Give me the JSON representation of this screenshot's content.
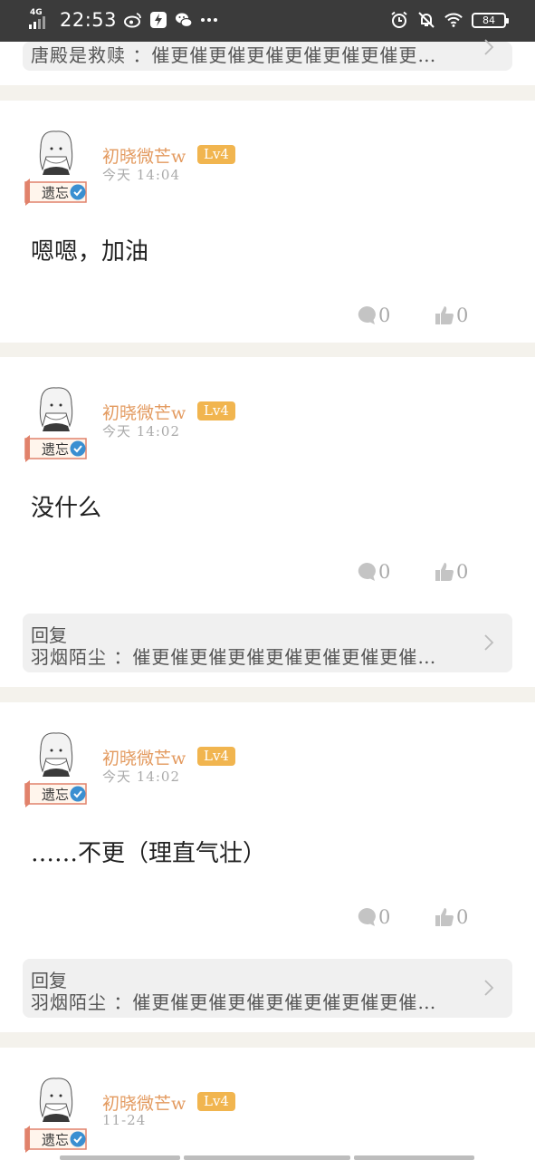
{
  "status_bar": {
    "network": "4G",
    "time": "22:53",
    "battery": "84"
  },
  "top_reply": {
    "text": "唐殿是救赎 ：催更催更催更催更催更催更催更…"
  },
  "comments": [
    {
      "username": "初晓微芒w",
      "level": "Lv4",
      "badge": "遗忘",
      "time": "今天 14:04",
      "content": "嗯嗯，加油",
      "reply_count": "0",
      "like_count": "0"
    },
    {
      "username": "初晓微芒w",
      "level": "Lv4",
      "badge": "遗忘",
      "time": "今天 14:02",
      "content": "没什么",
      "reply_count": "0",
      "like_count": "0",
      "reply": {
        "title": "回复",
        "text": "羽烟陌尘 ：催更催更催更催更催更催更催更催…"
      }
    },
    {
      "username": "初晓微芒w",
      "level": "Lv4",
      "badge": "遗忘",
      "time": "今天 14:02",
      "content": "……不更（理直气壮）",
      "reply_count": "0",
      "like_count": "0",
      "reply": {
        "title": "回复",
        "text": "羽烟陌尘 ：催更催更催更催更催更催更催更催…"
      }
    },
    {
      "username": "初晓微芒w",
      "level": "Lv4",
      "badge": "遗忘",
      "time": "11-24"
    }
  ],
  "colors": {
    "username": "#e39a5f",
    "level_badge": "#f1b54f",
    "page_bg": "#f4f2ec"
  },
  "icons": [
    "wifi-icon",
    "alarm-icon",
    "mute-bell-icon",
    "weibo-icon",
    "wechat-icon",
    "comment-icon",
    "thumbs-up-icon",
    "chevron-right-icon",
    "verified-icon"
  ]
}
